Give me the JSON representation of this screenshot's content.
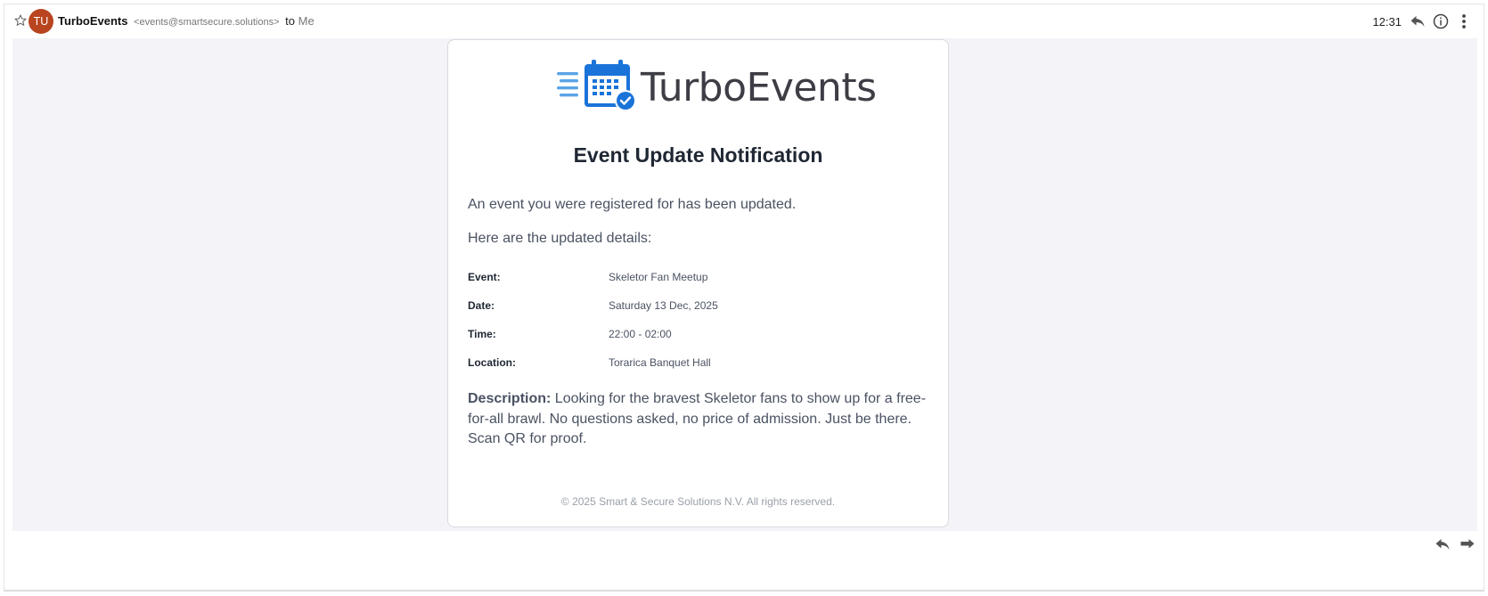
{
  "header": {
    "avatar_initials": "TU",
    "sender_name": "TurboEvents",
    "sender_address": "<events@smartsecure.solutions>",
    "to_label": "to",
    "recipient": "Me",
    "time": "12:31",
    "icons": [
      "star-icon",
      "reply-icon",
      "info-icon",
      "more-icon"
    ]
  },
  "email": {
    "logo_text": "TurboEvents",
    "title": "Event Update Notification",
    "intro": "An event you were registered for has been updated.",
    "details_intro": "Here are the updated details:",
    "details": [
      {
        "label": "Event:",
        "value": "Skeletor Fan Meetup"
      },
      {
        "label": "Date:",
        "value": "Saturday 13 Dec, 2025"
      },
      {
        "label": "Time:",
        "value": "22:00 - 02:00"
      },
      {
        "label": "Location:",
        "value": "Torarica Banquet Hall"
      }
    ],
    "description_label": "Description:",
    "description_text": " Looking for the bravest Skeletor fans to show up for a free-for-all brawl. No questions asked, no price of admission. Just be there. Scan QR for proof.",
    "footer": "© 2025 Smart & Secure Solutions N.V. All rights reserved."
  },
  "actions": {
    "icons": [
      "reply-icon",
      "forward-icon"
    ]
  },
  "colors": {
    "avatar": "#b8451f",
    "logo_blue": "#1a73d9",
    "logo_light_blue": "#5aa4e6",
    "body_bg": "#f3f3f8"
  }
}
